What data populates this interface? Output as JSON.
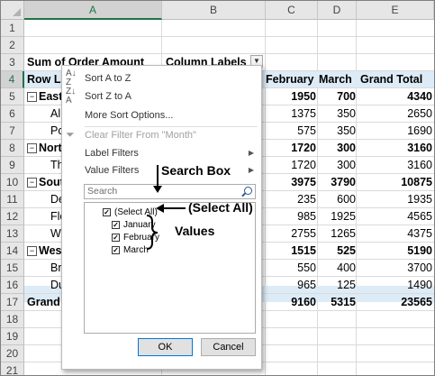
{
  "columns": [
    "A",
    "B",
    "C",
    "D",
    "E"
  ],
  "rows": [
    "1",
    "2",
    "3",
    "4",
    "5",
    "6",
    "7",
    "8",
    "9",
    "10",
    "11",
    "12",
    "13",
    "14",
    "15",
    "16",
    "17",
    "18",
    "19",
    "20",
    "21"
  ],
  "pivot": {
    "value_label": "Sum of Order Amount",
    "column_labels": "Column Labels",
    "row_labels_partial": "Row La",
    "headers": {
      "february": "February",
      "march": "March",
      "grand_total": "Grand Total"
    },
    "rows": [
      {
        "label": "East",
        "feb": "1950",
        "mar": "700",
        "total": "4340",
        "bold": true
      },
      {
        "label": "Al",
        "feb": "1375",
        "mar": "350",
        "total": "2650",
        "bold": false
      },
      {
        "label": "Po",
        "feb": "575",
        "mar": "350",
        "total": "1690",
        "bold": false
      },
      {
        "label": "Nort",
        "feb": "1720",
        "mar": "300",
        "total": "3160",
        "bold": true
      },
      {
        "label": "Th",
        "feb": "1720",
        "mar": "300",
        "total": "3160",
        "bold": false
      },
      {
        "label": "Sout",
        "feb": "3975",
        "mar": "3790",
        "total": "10875",
        "bold": true
      },
      {
        "label": "De",
        "feb": "235",
        "mar": "600",
        "total": "1935",
        "bold": false
      },
      {
        "label": "Flo",
        "feb": "985",
        "mar": "1925",
        "total": "4565",
        "bold": false
      },
      {
        "label": "W",
        "feb": "2755",
        "mar": "1265",
        "total": "4375",
        "bold": false
      },
      {
        "label": "West",
        "feb": "1515",
        "mar": "525",
        "total": "5190",
        "bold": true
      },
      {
        "label": "Br",
        "feb": "550",
        "mar": "400",
        "total": "3700",
        "bold": false
      },
      {
        "label": "Du",
        "feb": "965",
        "mar": "125",
        "total": "1490",
        "bold": false
      },
      {
        "label": "Grand",
        "feb": "9160",
        "mar": "5315",
        "total": "23565",
        "bold": true
      }
    ]
  },
  "menu": {
    "sort_az": "Sort A to Z",
    "sort_za": "Sort Z to A",
    "more_sort": "More Sort Options...",
    "clear_filter": "Clear Filter From \"Month\"",
    "label_filters": "Label Filters",
    "value_filters": "Value Filters",
    "search_placeholder": "Search",
    "list": [
      "(Select All)",
      "January",
      "February",
      "March"
    ],
    "ok": "OK",
    "cancel": "Cancel"
  },
  "annotations": {
    "search_box": "Search Box",
    "select_all": "(Select All)",
    "values": "Values"
  },
  "icons": [
    "sort-az-icon",
    "sort-za-icon",
    "clear-filter-icon",
    "search-icon",
    "dropdown-arrow-icon",
    "checkbox-checked-icon"
  ]
}
